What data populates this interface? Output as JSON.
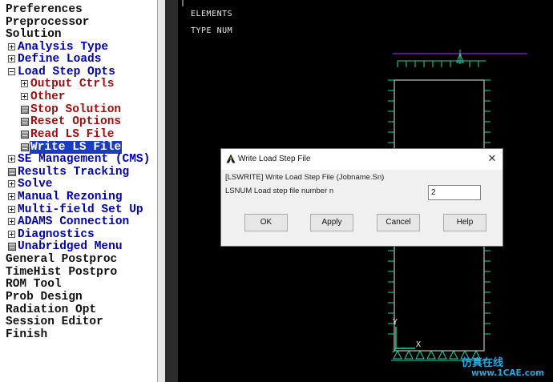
{
  "tree": {
    "items": [
      {
        "label": "Preferences"
      },
      {
        "label": "Preprocessor"
      },
      {
        "label": "Solution"
      },
      {
        "label": "Analysis Type"
      },
      {
        "label": "Define Loads"
      },
      {
        "label": "Load Step Opts"
      },
      {
        "label": "Output Ctrls"
      },
      {
        "label": "Other"
      },
      {
        "label": "Stop Solution"
      },
      {
        "label": "Reset Options"
      },
      {
        "label": "Read LS File"
      },
      {
        "label": "Write LS File"
      },
      {
        "label": "SE Management (CMS)"
      },
      {
        "label": "Results Tracking"
      },
      {
        "label": "Solve"
      },
      {
        "label": "Manual Rezoning"
      },
      {
        "label": "Multi-field Set Up"
      },
      {
        "label": "ADAMS Connection"
      },
      {
        "label": "Diagnostics"
      },
      {
        "label": "Unabridged Menu"
      },
      {
        "label": "General Postproc"
      },
      {
        "label": "TimeHist Postpro"
      },
      {
        "label": "ROM Tool"
      },
      {
        "label": "Prob Design"
      },
      {
        "label": "Radiation Opt"
      },
      {
        "label": "Session Editor"
      },
      {
        "label": "Finish"
      }
    ],
    "selected": "Write LS File"
  },
  "viewport": {
    "line1": "ELEMENTS",
    "line2": "TYPE NUM",
    "axis_x": "X",
    "axis_y": "Y"
  },
  "dialog": {
    "title": "Write Load Step File",
    "command_line": "[LSWRITE]  Write Load Step File (Jobname.Sn)",
    "field_label": "LSNUM  Load step file number n",
    "field_value": "2",
    "buttons": {
      "ok": "OK",
      "apply": "Apply",
      "cancel": "Cancel",
      "help": "Help"
    },
    "close": "✕"
  },
  "watermark": {
    "text": "仿真在线",
    "site": "www.1CAE.com"
  },
  "colors": {
    "viewport_bg": "#000000",
    "model_lines": "#22d3a8",
    "top_line": "#8a2be2",
    "selection": "#1c3cc0"
  }
}
